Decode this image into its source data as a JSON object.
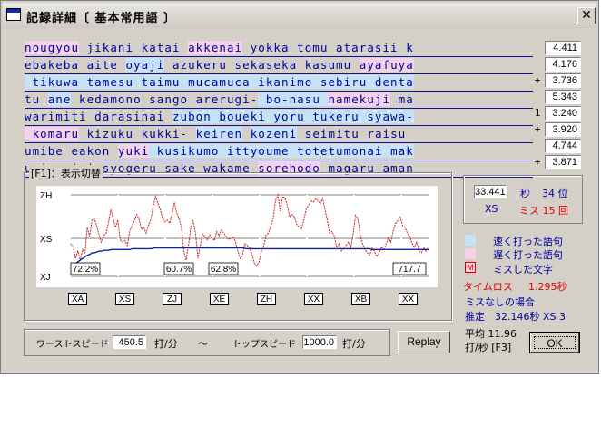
{
  "window": {
    "title": "記録詳細〔 基本常用語 〕",
    "close_icon": "close-icon"
  },
  "lines": [
    {
      "segments": [
        {
          "t": "nougyou",
          "c": "slow"
        },
        {
          "t": " jikani katai "
        },
        {
          "t": "akkenai",
          "c": "slow"
        },
        {
          "t": " yokka tomu atarasii k"
        }
      ],
      "mark": "",
      "speed": "4.411"
    },
    {
      "segments": [
        {
          "t": "ebakeba aite "
        },
        {
          "t": "oyaji",
          "c": "fast"
        },
        {
          "t": " azukeru sekaseka kasumu "
        },
        {
          "t": "ayafuya",
          "c": "slow"
        }
      ],
      "mark": "",
      "speed": "4.176"
    },
    {
      "segments": [
        {
          "t": " tikuwa tamesu taimu mucamuca ikanimo sebiru denta",
          "c": "fast"
        }
      ],
      "mark": "+",
      "speed": "3.736"
    },
    {
      "segments": [
        {
          "t": "tu "
        },
        {
          "t": "ane",
          "c": "fast"
        },
        {
          "t": " kedamono sango arerugi-"
        },
        {
          "t": " bo-nasu ",
          "c": "fast"
        },
        {
          "t": "namekuji",
          "c": "slow"
        },
        {
          "t": " ma"
        }
      ],
      "mark": "",
      "speed": "5.343"
    },
    {
      "segments": [
        {
          "t": "warimiti darasinai "
        },
        {
          "t": "zubon boueki yoru tukeru syawa-",
          "c": "fast"
        }
      ],
      "mark": "1",
      "speed": "3.240"
    },
    {
      "segments": [
        {
          "t": " komaru",
          "c": "slow"
        },
        {
          "t": " kizuku kukki- "
        },
        {
          "t": "keiren",
          "c": "fast"
        },
        {
          "t": " "
        },
        {
          "t": "kozeni",
          "c": "fast"
        },
        {
          "t": " seimitu raisu"
        }
      ],
      "mark": "+",
      "speed": "3.920"
    },
    {
      "segments": [
        {
          "t": "umibe eakon "
        },
        {
          "t": "yuki",
          "c": "slow"
        },
        {
          "t": " kusikumo ittyoume totetumonai mak",
          "c": "fast"
        }
      ],
      "mark": "",
      "speed": "4.744"
    },
    {
      "segments": [
        {
          "t": "ugire imi syogeru sake wakame "
        },
        {
          "t": "sorehodo",
          "c": "slow"
        },
        {
          "t": " magaru aman"
        }
      ],
      "mark": "+",
      "speed": "3.871"
    }
  ],
  "graph": {
    "group_label": "[F1]：表示切替",
    "axis_labels": [
      "ZH",
      "XS",
      "XJ"
    ],
    "percent_labels": [
      "72.2%",
      "60.7%",
      "62.8%"
    ],
    "speed_label": "717.7",
    "categories": [
      "XA",
      "XS",
      "ZJ",
      "XE",
      "ZH",
      "XX",
      "XB",
      "XX"
    ],
    "colors": {
      "red_series": "#d02020",
      "blue_series": "#1020a0"
    }
  },
  "chart_data": {
    "type": "line",
    "series": [
      {
        "values": [
          0.4,
          0.36,
          0.22,
          0.31,
          0.2,
          0.33,
          0.29,
          0.6,
          0.49,
          0.69,
          0.71,
          0.62,
          0.51,
          0.42,
          0.5,
          0.53,
          0.66,
          0.82,
          0.71,
          0.6,
          0.69,
          0.45,
          0.42,
          0.44,
          0.38,
          0.55,
          0.62,
          0.69,
          0.76,
          0.7,
          0.58,
          0.6,
          0.53,
          0.63,
          0.69,
          0.86,
          0.98,
          0.9,
          0.82,
          0.71,
          0.67,
          0.69,
          0.65,
          0.76,
          0.91,
          0.78,
          0.71,
          0.6,
          0.31,
          0.2,
          0.38,
          0.6,
          0.68,
          0.53,
          0.22,
          0.38,
          0.52,
          0.49,
          0.45,
          0.51,
          0.47,
          0.44,
          0.55,
          0.5,
          0.57,
          0.53,
          0.49,
          0.45,
          0.47,
          0.49,
          0.42,
          0.31,
          0.22,
          0.26,
          0.4,
          0.38,
          0.35,
          0.27,
          0.16,
          0.13,
          0.18,
          0.31,
          0.38,
          0.51,
          0.53,
          0.62,
          0.71,
          0.93,
          1.0,
          0.8,
          0.98,
          0.96,
          0.87,
          0.73,
          0.76,
          0.73,
          0.64,
          0.6,
          0.58,
          0.69,
          0.82,
          0.87,
          0.93,
          0.91,
          0.95,
          0.93,
          0.89,
          0.96,
          0.82,
          0.69,
          0.53,
          0.55,
          0.49,
          0.35,
          0.4,
          0.31,
          0.35,
          0.38,
          0.42,
          0.36,
          0.53,
          0.75,
          0.71,
          0.51,
          0.4,
          0.33,
          0.29,
          0.26,
          0.35,
          0.31,
          0.24,
          0.29,
          0.36,
          0.33,
          0.4,
          0.48,
          0.42,
          0.56,
          0.65,
          0.69,
          0.73,
          0.62,
          0.6,
          0.53,
          0.49,
          0.4,
          0.36,
          0.42,
          0.31,
          0.29,
          0.35,
          0.31,
          0.36
        ]
      },
      {
        "values": [
          0.11,
          0.13,
          0.16,
          0.18,
          0.2,
          0.22,
          0.24,
          0.26,
          0.27,
          0.29,
          0.29,
          0.3,
          0.31,
          0.31,
          0.32,
          0.32,
          0.32,
          0.33,
          0.33,
          0.33,
          0.33,
          0.33,
          0.33,
          0.33,
          0.33,
          0.33,
          0.34,
          0.34,
          0.34,
          0.34,
          0.34,
          0.34,
          0.34,
          0.34,
          0.34,
          0.35,
          0.35,
          0.35,
          0.35,
          0.35,
          0.35,
          0.35,
          0.35,
          0.35,
          0.35,
          0.35,
          0.35,
          0.35,
          0.35,
          0.35,
          0.35,
          0.35,
          0.35,
          0.35,
          0.35,
          0.35,
          0.35,
          0.35,
          0.35,
          0.35,
          0.35,
          0.35,
          0.35,
          0.35,
          0.35,
          0.35,
          0.35,
          0.35,
          0.35,
          0.35,
          0.35,
          0.35,
          0.35,
          0.35,
          0.34,
          0.34,
          0.34,
          0.34,
          0.34,
          0.34,
          0.34,
          0.34,
          0.34,
          0.34,
          0.34,
          0.34,
          0.34,
          0.34,
          0.34,
          0.34,
          0.34,
          0.34,
          0.34,
          0.34,
          0.34,
          0.34,
          0.34,
          0.34,
          0.34,
          0.34,
          0.34,
          0.34,
          0.34,
          0.34,
          0.34,
          0.34,
          0.34,
          0.34,
          0.34,
          0.34,
          0.34,
          0.34,
          0.34,
          0.34,
          0.34,
          0.34,
          0.34,
          0.34,
          0.34,
          0.34,
          0.34,
          0.34,
          0.34,
          0.34,
          0.34,
          0.34,
          0.34,
          0.33,
          0.33,
          0.33,
          0.33,
          0.33,
          0.33,
          0.33,
          0.33,
          0.33,
          0.33,
          0.33,
          0.33,
          0.33,
          0.33,
          0.33,
          0.33,
          0.33,
          0.33,
          0.33,
          0.33,
          0.33,
          0.33,
          0.33,
          0.33,
          0.33
        ]
      }
    ],
    "ylim": [
      0,
      1
    ]
  },
  "result": {
    "time": "33.441",
    "time_unit": "秒",
    "rank": "34 位",
    "grade": "XS",
    "miss": "ミス 15 回",
    "legend_fast": "速く打った語句",
    "legend_slow": "遅く打った語句",
    "legend_miss_glyph": "M",
    "legend_miss": "ミスした文字",
    "timeloss_label": "タイムロス",
    "timeloss_value": "1.295秒",
    "nomiss_label": "ミスなしの場合",
    "estimate_label": "推定",
    "estimate_value": "32.146秒 XS  3",
    "avg_line1": "平均 11.96",
    "avg_line2": "打/秒 [F3]",
    "colors": {
      "fast": "#c6e2f6",
      "slow": "#f4d2e8",
      "miss_box": "#e00000"
    }
  },
  "speeds": {
    "worst_label": "ワーストスピード",
    "worst_value": "450.5",
    "unit": "打/分",
    "tilde": "〜",
    "top_label": "トップスピード",
    "top_value": "1000.0"
  },
  "buttons": {
    "replay": "Replay",
    "ok": "OK"
  }
}
